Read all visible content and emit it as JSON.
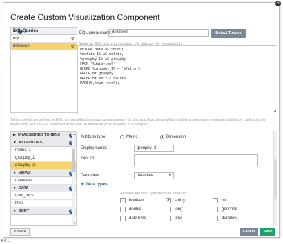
{
  "dialog": {
    "title": "Create Custom Visualization Component",
    "close_icon": "close-icon"
  },
  "eql_queries": {
    "header": "EQL Queries",
    "items": [
      {
        "name": "eql"
      },
      {
        "name": "drilldown"
      }
    ]
  },
  "query": {
    "name_label": "EQL query name:",
    "name_value": "drilldown",
    "detect_button": "Detect Tokens",
    "hint": "Write an EQL query to construct the data for the visualization",
    "lines": [
      "RETURN data AS SELECT",
      "%metric_1% AS metric,",
      "%groupby_1% AS groupby",
      "FROM \"%dataview%\"",
      "WHERE %groupby_1% = '%filter%'",
      "GROUP BY groupby",
      "ORDER BY metric %sort%",
      "PAGE(0,%num_recs%);"
    ]
  },
  "tokens_hint": "Tokens, which are defined by EQL, can be added to an appropriate category by drag and drop. Once added, additional options are available to define by clicking on the token name. For the EQL statement to be valid, all tokens must be assigned to a category.",
  "tokens": {
    "sections": [
      {
        "label": "UNASSIGNED TOKENS",
        "items": []
      },
      {
        "label": "ATTRIBUTES",
        "items": [
          "metric_1",
          "groupby_1",
          "groupby_2"
        ]
      },
      {
        "label": "VIEWS",
        "items": [
          "dataview"
        ]
      },
      {
        "label": "DATA",
        "items": [
          "num_recs",
          "filter"
        ]
      },
      {
        "label": "SORT",
        "items": []
      }
    ],
    "selected": "groupby_2"
  },
  "form": {
    "attribute_type_label": "Attribute type:",
    "type_options": [
      "Metric",
      "Dimension"
    ],
    "type_selected": "Dimension",
    "display_name_label": "Display name:",
    "display_name_value": "groupby_2",
    "tooltip_label": "Tool tip:",
    "data_view_label": "Data view:",
    "data_view_value": "dataview",
    "data_types_label": "Data types",
    "data_types_hint": "At least one data type must be selected.",
    "data_types": [
      {
        "label": "boolean",
        "checked": false
      },
      {
        "label": "string",
        "checked": true
      },
      {
        "label": "int",
        "checked": false
      },
      {
        "label": "double",
        "checked": false
      },
      {
        "label": "long",
        "checked": false
      },
      {
        "label": "geocode",
        "checked": false
      },
      {
        "label": "dateTime",
        "checked": false
      },
      {
        "label": "time",
        "checked": false
      },
      {
        "label": "duration",
        "checked": false
      }
    ]
  },
  "footer": {
    "back": "< Back",
    "cancel": "Cancel",
    "save": "Save"
  },
  "below_text": "ft 6 ..."
}
